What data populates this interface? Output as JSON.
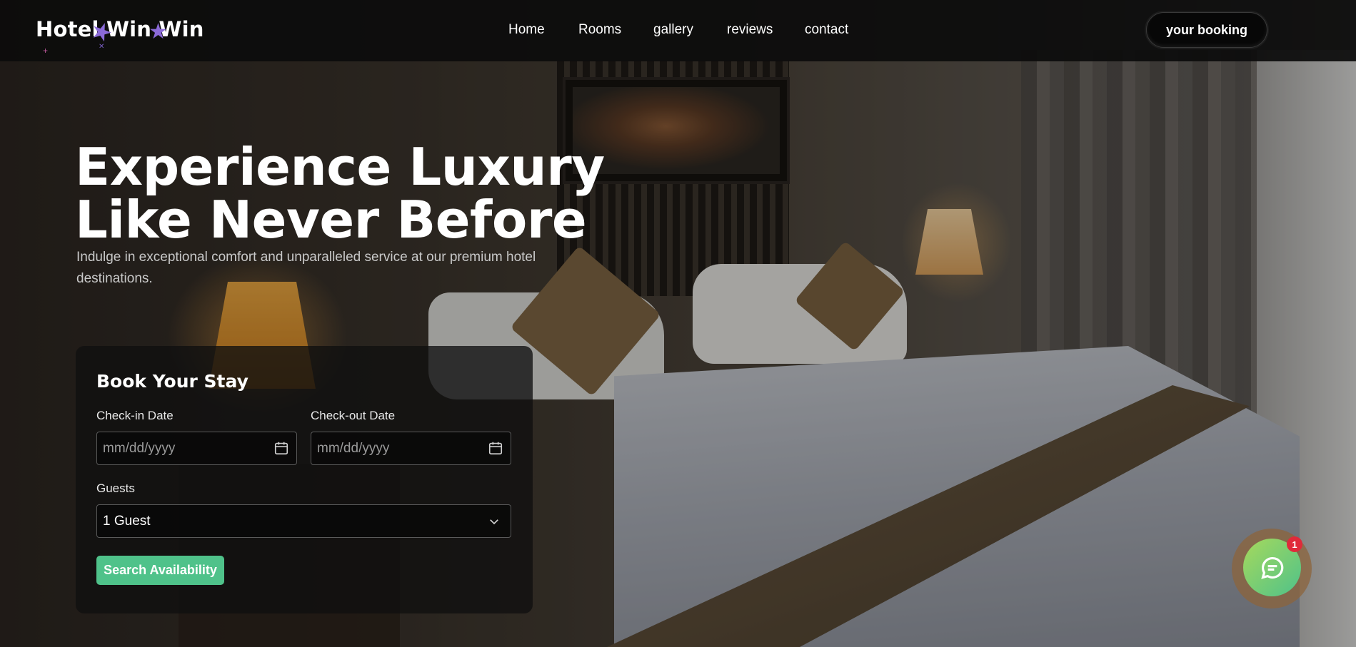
{
  "brand": {
    "logo_text": "Hotel Win Win"
  },
  "nav": {
    "items": [
      {
        "label": "Home"
      },
      {
        "label": "Rooms"
      },
      {
        "label": "gallery"
      },
      {
        "label": "reviews"
      },
      {
        "label": "contact"
      }
    ],
    "booking_label": "your booking"
  },
  "hero": {
    "title_line1": "Experience Luxury",
    "title_line2": "Like Never Before",
    "subtitle": "Indulge in exceptional comfort and unparalleled service at our premium hotel destinations."
  },
  "booking_form": {
    "title": "Book Your Stay",
    "checkin_label": "Check-in Date",
    "checkin_placeholder": "mm/dd/yyyy",
    "checkout_label": "Check-out Date",
    "checkout_placeholder": "mm/dd/yyyy",
    "guests_label": "Guests",
    "guests_value": "1 Guest",
    "search_label": "Search Availability"
  },
  "chat": {
    "badge_count": "1",
    "icon": "chat-icon"
  },
  "colors": {
    "accent_green": "#4fc28a",
    "star_purple": "#8b6ad8",
    "badge_red": "#e02a3a"
  }
}
